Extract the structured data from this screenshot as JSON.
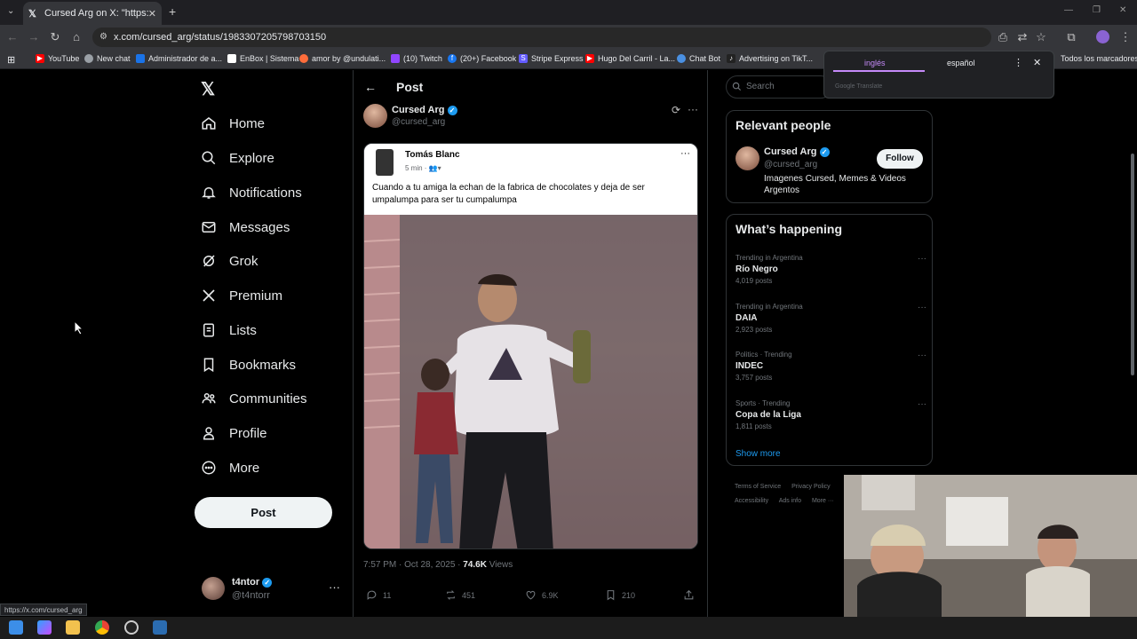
{
  "browser": {
    "tab_title": "Cursed Arg on X: \"https://t.co/...",
    "tab_close": "✕",
    "new_tab": "+",
    "url": "x.com/cursed_arg/status/1983307205798703150",
    "bookmarks": [
      {
        "label": "YouTube",
        "color": "#ff0000"
      },
      {
        "label": "New chat",
        "color": "#9aa0a6"
      },
      {
        "label": "Administrador de a...",
        "color": "#1a73e8"
      },
      {
        "label": "EnBox | Sistema",
        "color": "#ffffff"
      },
      {
        "label": "amor by @undulati...",
        "color": "#ff6d3b"
      },
      {
        "label": "(10) Twitch",
        "color": "#9146ff"
      },
      {
        "label": "(20+) Facebook",
        "color": "#1877f2"
      },
      {
        "label": "Stripe Express",
        "color": "#635bff"
      },
      {
        "label": "Hugo Del Carril - La...",
        "color": "#ff0000"
      },
      {
        "label": "Chat Bot",
        "color": "#4a90e2"
      },
      {
        "label": "Advertising on TikT...",
        "color": "#ffffff"
      }
    ],
    "bookmarks_all": "Todos los marcadores",
    "status_url": "https://x.com/cursed_arg"
  },
  "translate_popup": {
    "source": "inglés",
    "target": "español",
    "brand": "Google Translate"
  },
  "sidebar": {
    "items": [
      {
        "label": "Home",
        "icon": "home-icon"
      },
      {
        "label": "Explore",
        "icon": "search-icon"
      },
      {
        "label": "Notifications",
        "icon": "bell-icon"
      },
      {
        "label": "Messages",
        "icon": "mail-icon"
      },
      {
        "label": "Grok",
        "icon": "grok-icon"
      },
      {
        "label": "Premium",
        "icon": "x-icon"
      },
      {
        "label": "Lists",
        "icon": "list-icon"
      },
      {
        "label": "Bookmarks",
        "icon": "bookmark-icon"
      },
      {
        "label": "Communities",
        "icon": "communities-icon"
      },
      {
        "label": "Profile",
        "icon": "person-icon"
      },
      {
        "label": "More",
        "icon": "more-circle-icon"
      }
    ],
    "post_button": "Post",
    "account": {
      "name": "t4ntor",
      "handle": "@t4ntorr"
    }
  },
  "post": {
    "header": "Post",
    "author": {
      "name": "Cursed Arg",
      "handle": "@cursed_arg"
    },
    "embed": {
      "name": "Tomás Blanc",
      "time": "5 min",
      "caption": "Cuando a tu amiga la echan de la fabrica de chocolates y deja de ser umpalumpa para ser tu cumpalumpa"
    },
    "timestamp": "7:57 PM · Oct 28, 2025 · ",
    "views_count": "74.6K",
    "views_label": " Views",
    "replies": "11",
    "reposts": "451",
    "likes": "6.9K",
    "bookmarks": "210"
  },
  "right": {
    "search_placeholder": "Search",
    "relevant_title": "Relevant people",
    "relevant": {
      "name": "Cursed Arg",
      "handle": "@cursed_arg",
      "follow": "Follow",
      "bio": "Imagenes Cursed, Memes & Videos Argentos"
    },
    "happening_title": "What’s happening",
    "trends": [
      {
        "meta": "Trending in Argentina",
        "name": "Río Negro",
        "count": "4,019 posts"
      },
      {
        "meta": "Trending in Argentina",
        "name": "DAIA",
        "count": "2,923 posts"
      },
      {
        "meta": "Politics · Trending",
        "name": "INDEC",
        "count": "3,757 posts"
      },
      {
        "meta": "Sports · Trending",
        "name": "Copa de la Liga",
        "count": "1,811 posts"
      }
    ],
    "show_more": "Show more",
    "footer": [
      "Terms of Service",
      "Privacy Policy",
      "Accessibility",
      "Ads info",
      "More ···"
    ]
  },
  "colors": {
    "accent": "#1d9bf0",
    "background": "#000000",
    "translate_accent": "#c58af9"
  }
}
